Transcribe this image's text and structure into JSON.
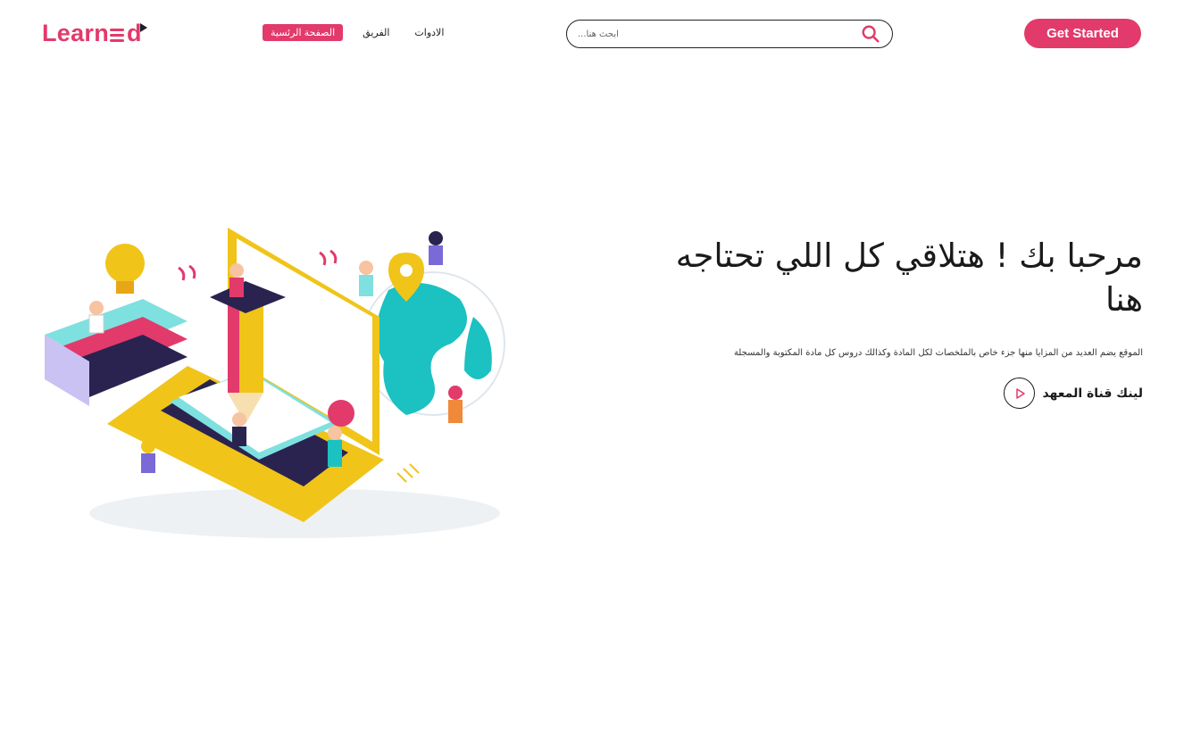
{
  "brand": {
    "name_prefix": "Learn",
    "name_suffix": "d",
    "accent_color": "#e23a6b"
  },
  "nav": {
    "items": [
      {
        "label": "الصفحة الرئسية",
        "active": true
      },
      {
        "label": "الفريق",
        "active": false
      },
      {
        "label": "الادوات",
        "active": false
      }
    ]
  },
  "search": {
    "placeholder": "ابحث هنا...",
    "value": "",
    "icon": "search-icon"
  },
  "header": {
    "cta_label": "Get Started"
  },
  "hero": {
    "title": "مرحبا بك ! هتلاقي كل اللي تحتاجه هنا",
    "description": "الموقع يضم العديد من المزايا منها جزء خاص بالملخصات لكل المادة وكذالك دروس كل مادة المكتوبة والمسجلة",
    "link_label": "لينك قناة المعهد",
    "link_icon": "play-icon"
  }
}
